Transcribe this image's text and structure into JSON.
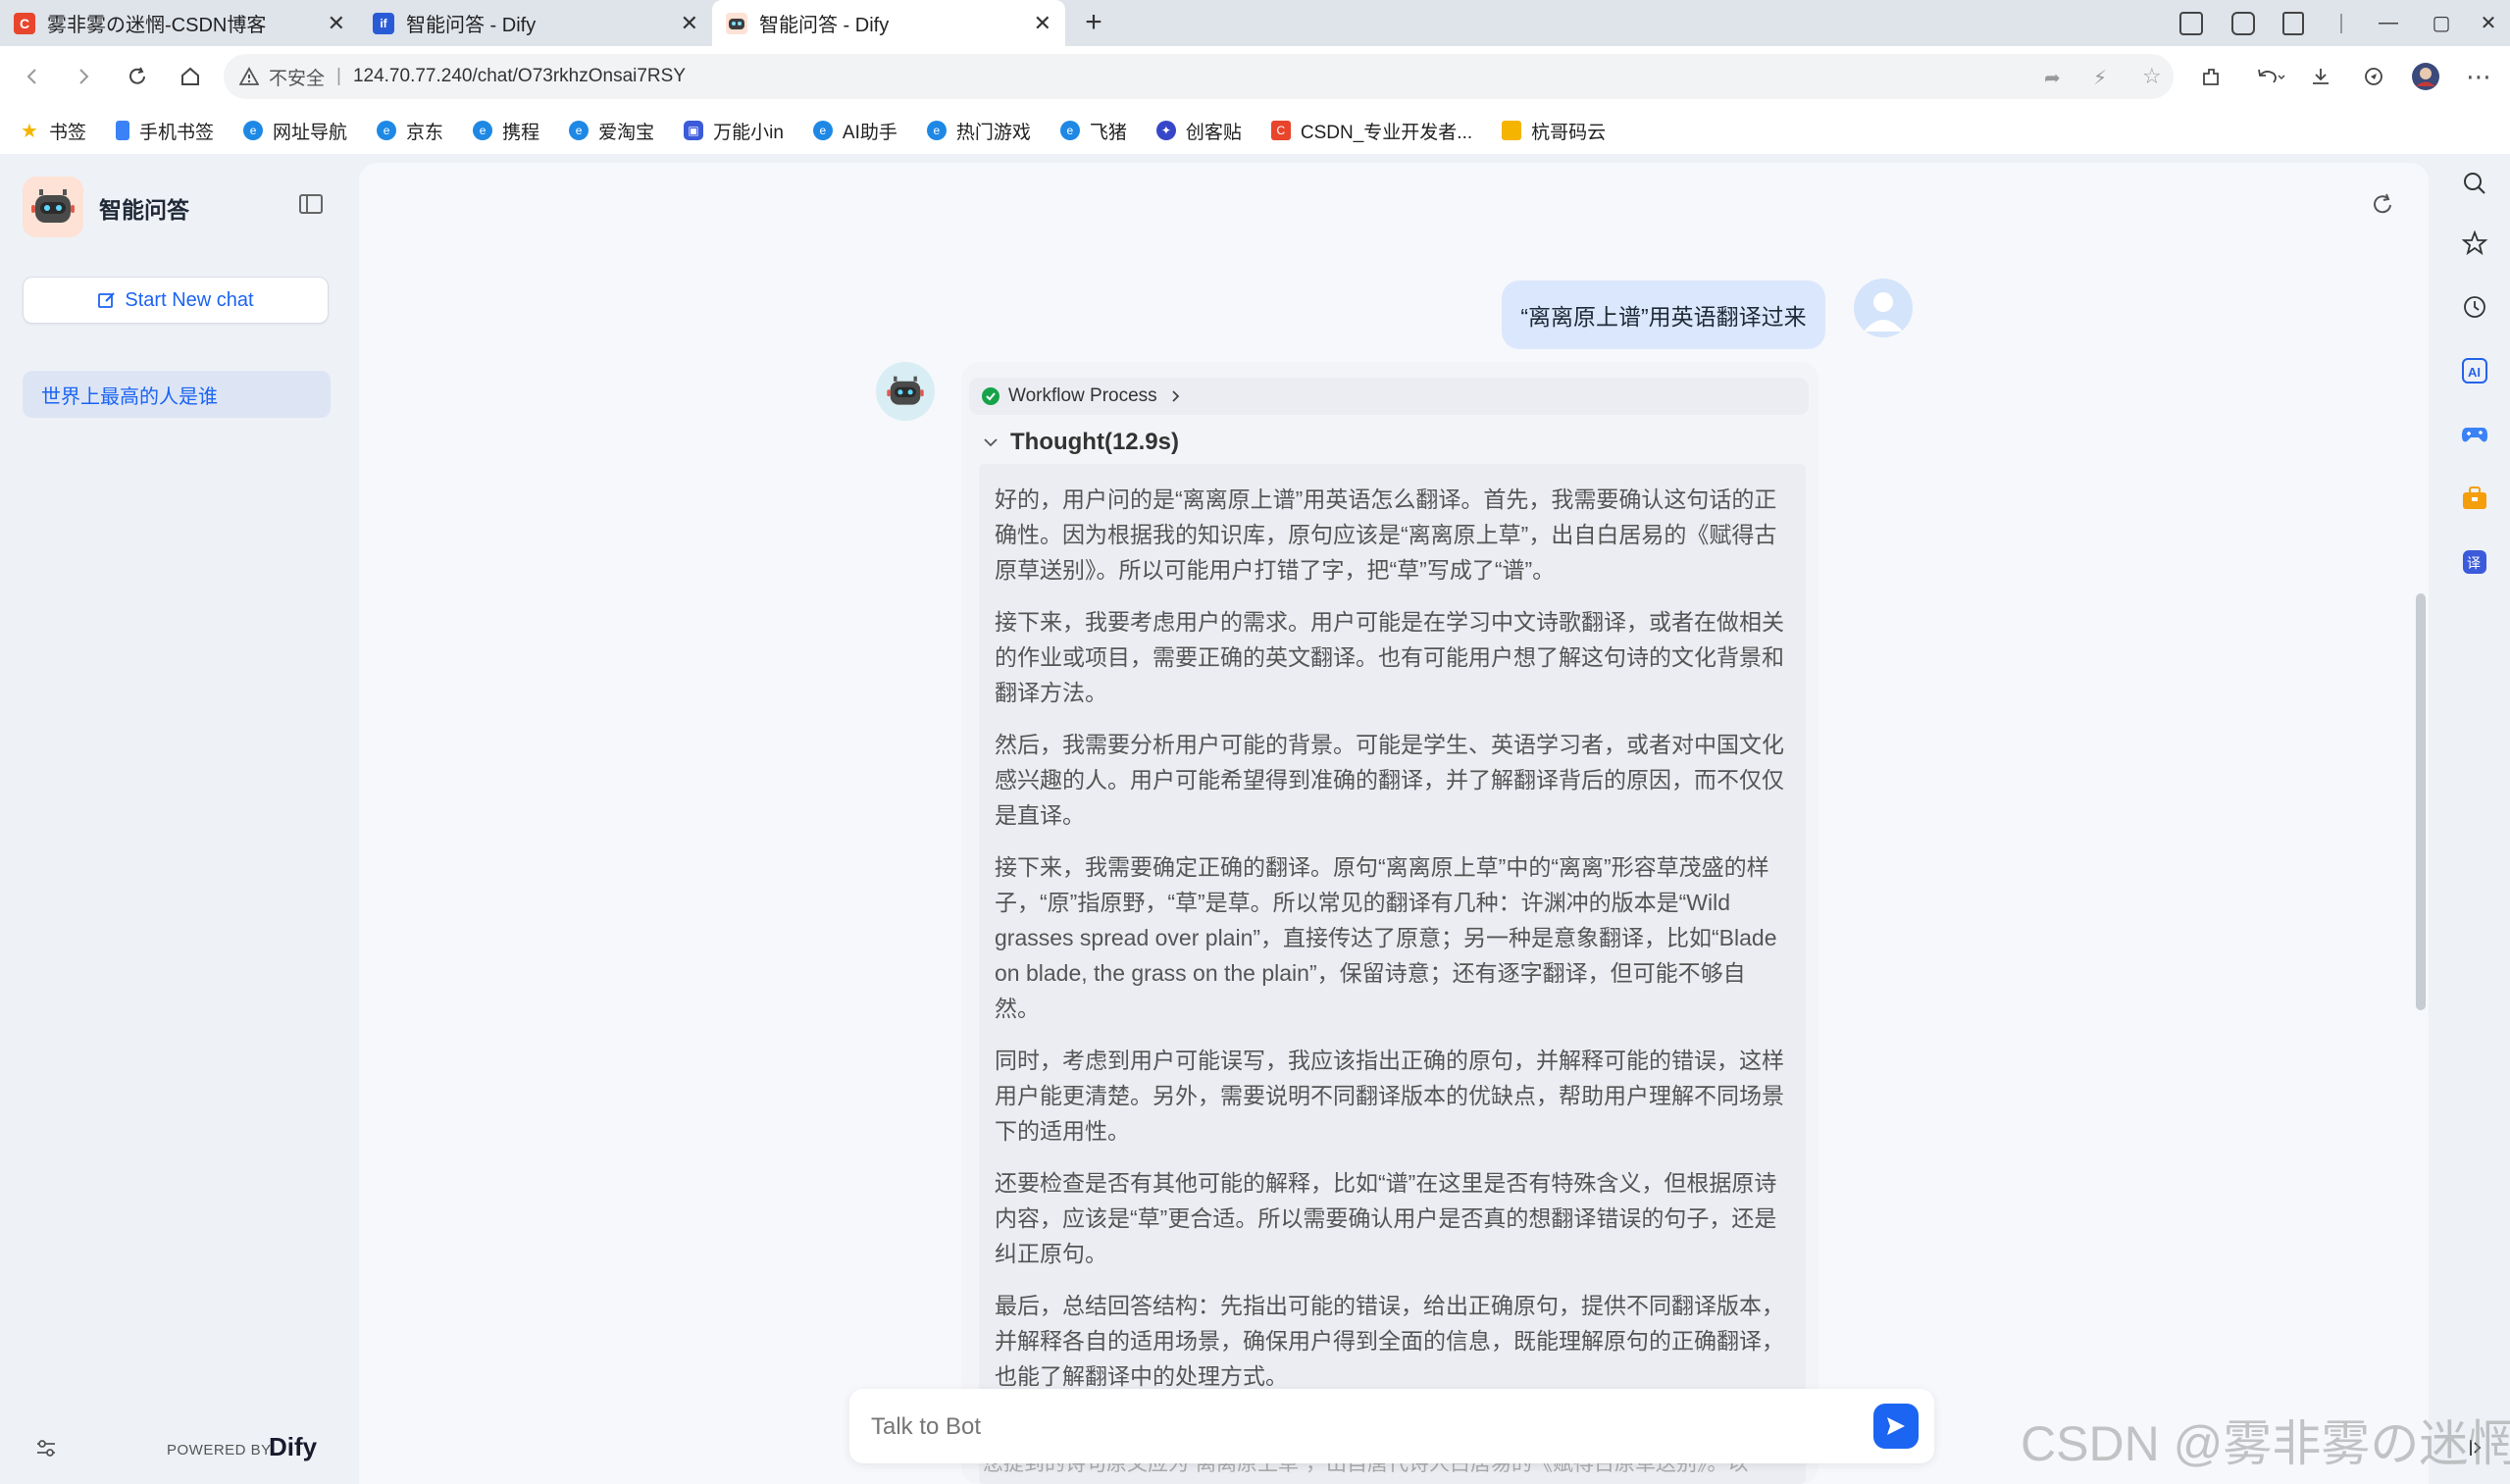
{
  "tabs": [
    {
      "title": "雾非雾の迷惘-CSDN博客",
      "favicon": "C"
    },
    {
      "title": "智能问答 - Dify",
      "favicon": "if"
    },
    {
      "title": "智能问答 - Dify",
      "favicon": "bot"
    }
  ],
  "new_tab": "+",
  "window_controls": [
    "—",
    "▢",
    "✕"
  ],
  "address": {
    "security": "不安全",
    "url": "124.70.77.240/chat/O73rkhzOnsai7RSY"
  },
  "bookmarks": [
    "书签",
    "手机书签",
    "网址导航",
    "京东",
    "携程",
    "爱淘宝",
    "万能小in",
    "AI助手",
    "热门游戏",
    "飞猪",
    "创客贴",
    "CSDN_专业开发者...",
    "杭哥码云"
  ],
  "app": {
    "name": "智能问答",
    "new_chat": "Start New chat",
    "conversations": [
      "世界上最高的人是谁"
    ],
    "powered_by": "POWERED BY",
    "brand": "Dify"
  },
  "chat": {
    "user_message": "“离离原上谱”用英语翻译过来",
    "workflow_label": "Workflow Process",
    "thought_label": "Thought(12.9s)",
    "thought_paragraphs": [
      "好的，用户问的是“离离原上谱”用英语怎么翻译。首先，我需要确认这句话的正确性。因为根据我的知识库，原句应该是“离离原上草”，出自白居易的《赋得古原草送别》。所以可能用户打错了字，把“草”写成了“谱”。",
      "接下来，我要考虑用户的需求。用户可能是在学习中文诗歌翻译，或者在做相关的作业或项目，需要正确的英文翻译。也有可能用户想了解这句诗的文化背景和翻译方法。",
      "然后，我需要分析用户可能的背景。可能是学生、英语学习者，或者对中国文化感兴趣的人。用户可能希望得到准确的翻译，并了解翻译背后的原因，而不仅仅是直译。",
      "接下来，我需要确定正确的翻译。原句“离离原上草”中的“离离”形容草茂盛的样子，“原”指原野，“草”是草。所以常见的翻译有几种：许渊冲的版本是“Wild grasses spread over plain”，直接传达了原意；另一种是意象翻译，比如“Blade on blade, the grass on the plain”，保留诗意；还有逐字翻译，但可能不够自然。",
      "同时，考虑到用户可能误写，我应该指出正确的原句，并解释可能的错误，这样用户能更清楚。另外，需要说明不同翻译版本的优缺点，帮助用户理解不同场景下的适用性。",
      "还要检查是否有其他可能的解释，比如“谱”在这里是否有特殊含义，但根据原诗内容，应该是“草”更合适。所以需要确认用户是否真的想翻译错误的句子，还是纠正原句。",
      "最后，总结回答结构：先指出可能的错误，给出正确原句，提供不同翻译版本，并解释各自的适用场景，确保用户得到全面的信息，既能理解原句的正确翻译，也能了解翻译中的处理方式。"
    ],
    "input_placeholder": "Talk to Bot",
    "behind_text": "您提到的诗句原文应为“离离原上草”，出自唐代诗人白居易的《赋得古原草送别》。以"
  },
  "watermark": "CSDN @雾非雾の迷惘",
  "colors": {
    "accent": "#1c64f2",
    "user_bubble": "#dbe7fc",
    "success": "#16a34a"
  }
}
